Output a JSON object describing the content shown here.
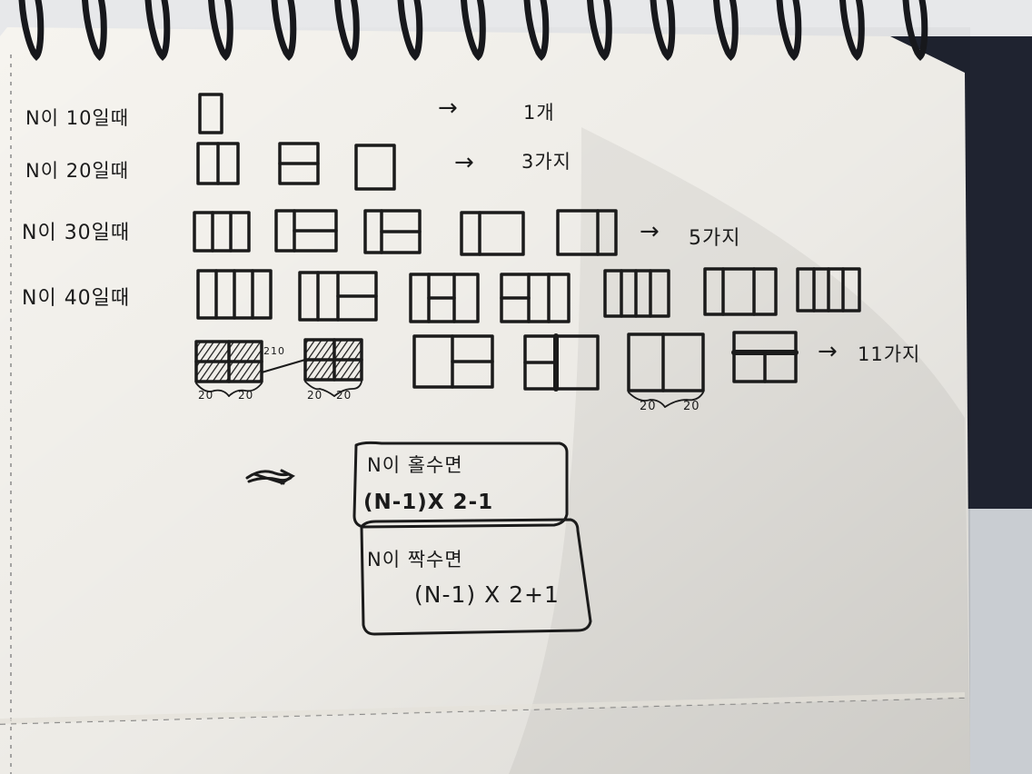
{
  "notes": {
    "row_labels": [
      "N이 10일때",
      "N이 20일때",
      "N이 30일때",
      "N이 40일때"
    ],
    "results": [
      "1개",
      "3가지",
      "5가지",
      "11가지"
    ],
    "arrow": "→",
    "dim_labels": [
      "20",
      "20",
      "210",
      "20",
      "20",
      "20",
      "20"
    ],
    "odd_rule": {
      "condition": "N이 홀수면",
      "formula": "(N-1)X 2-1"
    },
    "even_rule": {
      "condition": "N이 짝수면",
      "formula": "(N-1) X 2+1"
    }
  },
  "colors": {
    "ink": "#1b1b1b",
    "paper": "#f6f4ef",
    "background_dark": "#1f2330",
    "background_light": "#c9cdd2"
  }
}
